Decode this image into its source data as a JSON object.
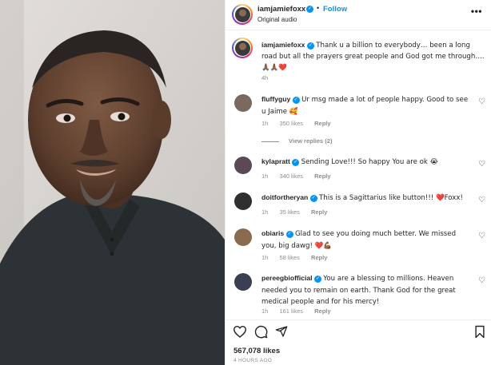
{
  "post": {
    "username": "iamjamiefoxx",
    "separator": "•",
    "follow_label": "Follow",
    "audio_label": "Original audio",
    "more_icon": "more-horizontal-icon",
    "caption": "Thank u a billion to everybody… been a long road but all the prayers great people and God got me through…. 🙏🏾🙏🏾❤️",
    "caption_time": "4h",
    "likes": "567,078 likes",
    "posted_ago": "4 HOURS AGO"
  },
  "comments": [
    {
      "username": "fluffyguy",
      "verified": true,
      "text": "Ur msg made a lot of people happy. Good to see u Jaime 🥰",
      "time": "1h",
      "likes": "350 likes",
      "reply_label": "Reply",
      "avatar_color": "#7a6a5e"
    },
    {
      "username": "kylapratt",
      "verified": true,
      "text": "Sending Love!!! So happy You are ok 😭",
      "time": "1h",
      "likes": "340 likes",
      "reply_label": "Reply",
      "avatar_color": "#5a4a58"
    },
    {
      "username": "doitforthery an",
      "verified": true,
      "text": "This is a Sagittarius like button!!! ❤️Foxx!",
      "time": "1h",
      "likes": "35 likes",
      "reply_label": "Reply",
      "avatar_color": "#2f2f2f"
    },
    {
      "username": "obiaris",
      "verified": true,
      "text": "Glad to see you doing much better. We missed you, big dawg! ❤️💪🏾",
      "time": "1h",
      "likes": "58 likes",
      "reply_label": "Reply",
      "avatar_color": "#8b6b4e"
    },
    {
      "username": "pereegbiofficial",
      "verified": true,
      "text": "You are a blessing to millions. Heaven needed you to remain on earth. Thank God for the great medical people and for his mercy!",
      "time": "1h",
      "likes": "161 likes",
      "reply_label": "Reply",
      "avatar_color": "#3b3f52"
    }
  ],
  "view_replies": "View replies (2)",
  "icons": {
    "like": "heart-outline-icon",
    "comment": "comment-bubble-icon",
    "share": "paper-plane-icon",
    "save": "bookmark-icon",
    "verified": "verified-badge-icon"
  },
  "colors": {
    "link_blue": "#0095f6",
    "text": "#262626",
    "muted": "#8e8e8e",
    "divider": "#efefef",
    "shirt": "#2c3236"
  }
}
